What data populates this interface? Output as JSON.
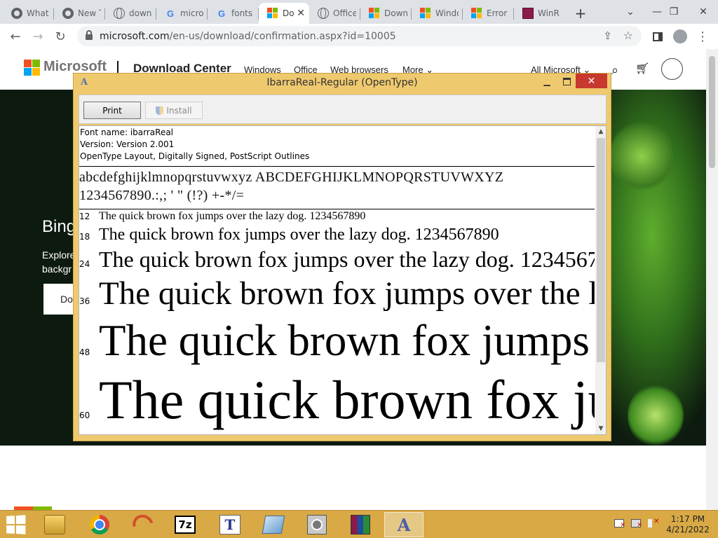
{
  "browser": {
    "tabs": [
      {
        "title": "What",
        "icon": "chrome-icon"
      },
      {
        "title": "New T",
        "icon": "chrome-icon"
      },
      {
        "title": "down",
        "icon": "globe-icon"
      },
      {
        "title": "micro",
        "icon": "google-icon"
      },
      {
        "title": "fonts",
        "icon": "google-icon"
      },
      {
        "title": "Do",
        "icon": "microsoft-icon",
        "active": true
      },
      {
        "title": "Office",
        "icon": "globe-icon"
      },
      {
        "title": "Down",
        "icon": "microsoft-icon"
      },
      {
        "title": "Windo",
        "icon": "microsoft-icon"
      },
      {
        "title": "Error -",
        "icon": "microsoft-icon"
      },
      {
        "title": "WinR",
        "icon": "winrar-icon"
      }
    ],
    "close_symbol": "✕",
    "new_tab_symbol": "+",
    "url_host": "microsoft.com",
    "url_path": "/en-us/download/confirmation.aspx?id=10005"
  },
  "page": {
    "brand": "Microsoft",
    "section": "Download Center",
    "nav": [
      "Windows",
      "Office",
      "Web browsers",
      "More ⌄"
    ],
    "all_microsoft": "All Microsoft ⌄",
    "hero_title": "Bing",
    "hero_sub": "Explore backgr",
    "hero_button": "Do"
  },
  "font_viewer": {
    "title": "IbarraReal-Regular (OpenType)",
    "print_label": "Print",
    "install_label": "Install",
    "font_name": "Font name: ibarraReal",
    "version": "Version: Version 2.001",
    "features": "OpenType Layout, Digitally Signed, PostScript Outlines",
    "charset_line1": "abcdefghijklmnopqrstuvwxyz ABCDEFGHIJKLMNOPQRSTUVWXYZ",
    "charset_line2": "1234567890.:,; ' \" (!?) +-*/=",
    "sample_text": "The quick brown fox jumps over the lazy dog. 1234567890",
    "sizes": [
      "12",
      "18",
      "24",
      "36",
      "48",
      "60"
    ]
  },
  "taskbar": {
    "apps": [
      "file-explorer-icon",
      "chrome-icon",
      "arc-icon",
      "7zip-icon",
      "typing-tutor-icon",
      "notepad-icon",
      "disk-utility-icon",
      "winrar-icon",
      "font-viewer-icon"
    ],
    "time": "1:17 PM",
    "date": "4/21/2022",
    "accent": "#d8a945"
  }
}
